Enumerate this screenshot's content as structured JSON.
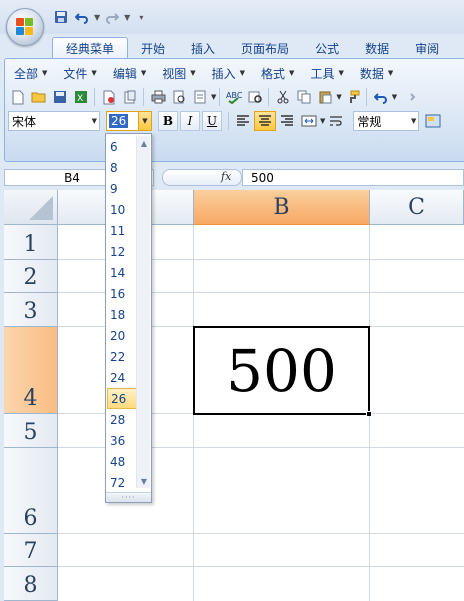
{
  "quick_access": {
    "icons": [
      "save-icon",
      "undo-icon",
      "redo-icon",
      "customize-icon"
    ]
  },
  "tabs": [
    {
      "label": "经典菜单",
      "active": true
    },
    {
      "label": "开始",
      "active": false
    },
    {
      "label": "插入",
      "active": false
    },
    {
      "label": "页面布局",
      "active": false
    },
    {
      "label": "公式",
      "active": false
    },
    {
      "label": "数据",
      "active": false
    },
    {
      "label": "审阅",
      "active": false
    }
  ],
  "menubar": [
    {
      "label": "全部"
    },
    {
      "label": "文件"
    },
    {
      "label": "编辑"
    },
    {
      "label": "视图"
    },
    {
      "label": "插入"
    },
    {
      "label": "格式"
    },
    {
      "label": "工具"
    },
    {
      "label": "数据"
    }
  ],
  "format": {
    "font_name": "宋体",
    "font_size": "26",
    "bold": "B",
    "italic": "I",
    "underline": "U",
    "number_format": "常规"
  },
  "formula_bar": {
    "cell_ref": "B4",
    "fx_label": "fx",
    "value": "500"
  },
  "grid": {
    "columns": [
      {
        "label": "",
        "selected": false
      },
      {
        "label": "B",
        "selected": true
      },
      {
        "label": "C",
        "selected": false
      }
    ],
    "rows": [
      {
        "label": "1",
        "selected": false
      },
      {
        "label": "2",
        "selected": false
      },
      {
        "label": "3",
        "selected": false
      },
      {
        "label": "4",
        "selected": true
      },
      {
        "label": "5",
        "selected": false
      },
      {
        "label": "6",
        "selected": false
      },
      {
        "label": "7",
        "selected": false
      },
      {
        "label": "8",
        "selected": false
      }
    ],
    "active_cell_value": "500"
  },
  "font_size_dropdown": {
    "options": [
      "6",
      "8",
      "9",
      "10",
      "11",
      "12",
      "14",
      "16",
      "18",
      "20",
      "22",
      "24",
      "26",
      "28",
      "36",
      "48",
      "72"
    ],
    "selected": "26"
  },
  "colors": {
    "accent": "#15428b",
    "selection_orange": "#f8a865",
    "ribbon_border": "#8db2e3"
  }
}
